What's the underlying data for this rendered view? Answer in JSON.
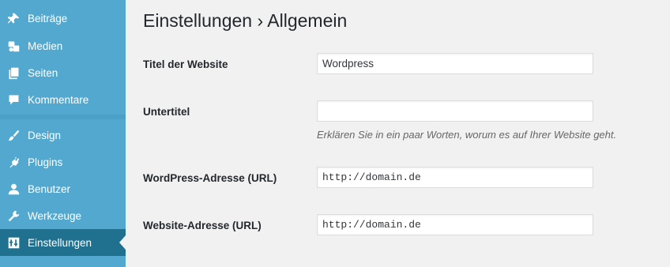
{
  "sidebar": {
    "items": [
      {
        "label": "Beiträge",
        "icon": "pin-icon"
      },
      {
        "label": "Medien",
        "icon": "media-icon"
      },
      {
        "label": "Seiten",
        "icon": "pages-icon"
      },
      {
        "label": "Kommentare",
        "icon": "comment-icon"
      },
      {
        "label": "Design",
        "icon": "brush-icon"
      },
      {
        "label": "Plugins",
        "icon": "plugin-icon"
      },
      {
        "label": "Benutzer",
        "icon": "user-icon"
      },
      {
        "label": "Werkzeuge",
        "icon": "wrench-icon"
      },
      {
        "label": "Einstellungen",
        "icon": "settings-icon",
        "active": true
      }
    ],
    "colors": {
      "background": "#53a8cf",
      "active": "#20708f"
    }
  },
  "page": {
    "title": "Einstellungen › Allgemein"
  },
  "form": {
    "site_title": {
      "label": "Titel der Website",
      "value": "Wordpress"
    },
    "tagline": {
      "label": "Untertitel",
      "value": "",
      "description": "Erklären Sie in ein paar Worten, worum es auf Ihrer Website geht."
    },
    "wp_address": {
      "label": "WordPress-Adresse (URL)",
      "value": "http://domain.de"
    },
    "site_address": {
      "label": "Website-Adresse (URL)",
      "value": "http://domain.de"
    }
  }
}
